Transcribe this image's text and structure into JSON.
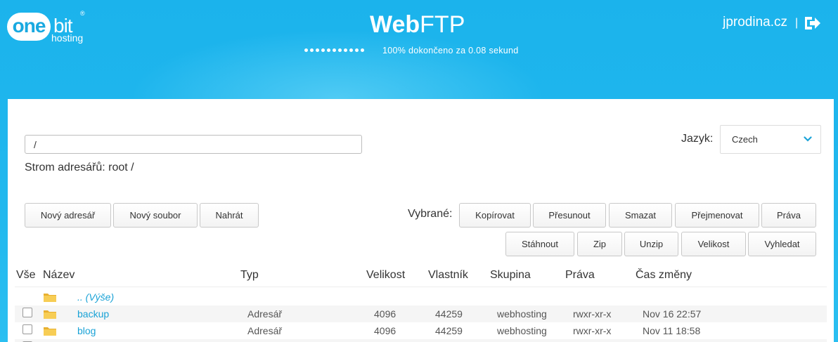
{
  "brand": {
    "one": "one",
    "bit": "bit",
    "reg": "®",
    "hosting": "hosting"
  },
  "header": {
    "title_bold": "Web",
    "title_rest": "FTP",
    "status": "100% dokončeno za 0.08 sekund",
    "user": "jprodina.cz",
    "separator": "|"
  },
  "path": {
    "value": "/"
  },
  "tree": {
    "label": "Strom adresářů: root /"
  },
  "language": {
    "label": "Jazyk:",
    "selected": "Czech"
  },
  "actions": {
    "new_dir": "Nový adresář",
    "new_file": "Nový soubor",
    "upload": "Nahrát"
  },
  "selected": {
    "label": "Vybrané:",
    "copy": "Kopírovat",
    "move": "Přesunout",
    "delete": "Smazat",
    "rename": "Přejmenovat",
    "rights": "Práva",
    "download": "Stáhnout",
    "zip": "Zip",
    "unzip": "Unzip",
    "size": "Velikost",
    "search": "Vyhledat"
  },
  "table": {
    "headers": {
      "all": "Vše",
      "name": "Název",
      "type": "Typ",
      "size": "Velikost",
      "owner": "Vlastník",
      "group": "Skupina",
      "rights": "Práva",
      "mtime": "Čas změny"
    },
    "up_label": ".. (Výše)",
    "rows": [
      {
        "name": "backup",
        "type": "Adresář",
        "size": "4096",
        "owner": "44259",
        "group": "webhosting",
        "rights": "rwxr-xr-x",
        "mtime": "Nov 16 22:57"
      },
      {
        "name": "blog",
        "type": "Adresář",
        "size": "4096",
        "owner": "44259",
        "group": "webhosting",
        "rights": "rwxr-xr-x",
        "mtime": "Nov 11 18:58"
      }
    ]
  },
  "colors": {
    "accent": "#1bb3ec",
    "link": "#19a2d6",
    "folder": "#f5c242"
  }
}
